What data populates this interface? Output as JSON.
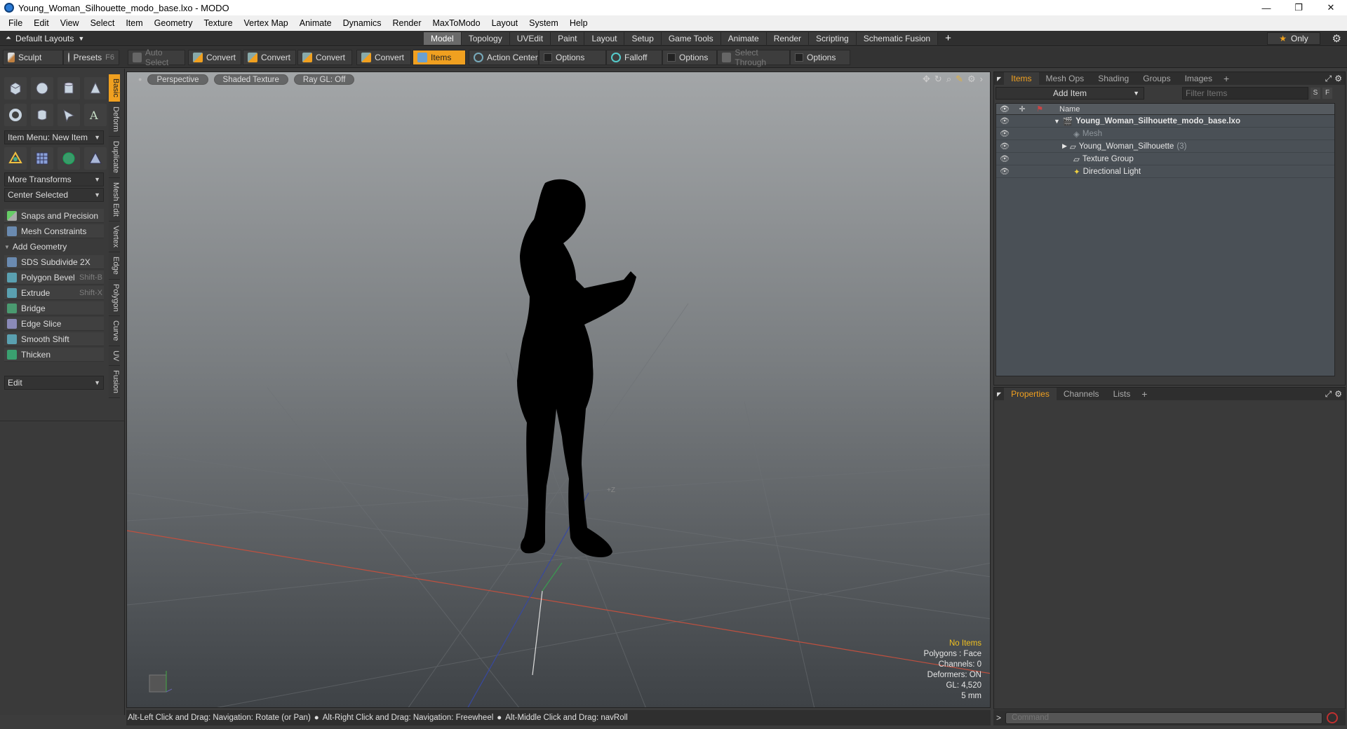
{
  "window": {
    "title": "Young_Woman_Silhouette_modo_base.lxo - MODO",
    "buttons": [
      "—",
      "❐",
      "✕"
    ]
  },
  "menubar": [
    "File",
    "Edit",
    "View",
    "Select",
    "Item",
    "Geometry",
    "Texture",
    "Vertex Map",
    "Animate",
    "Dynamics",
    "Render",
    "MaxToModo",
    "Layout",
    "System",
    "Help"
  ],
  "layoutbar": {
    "layout_name": "Default Layouts",
    "tabs": [
      "Model",
      "Topology",
      "UVEdit",
      "Paint",
      "Layout",
      "Setup",
      "Game Tools",
      "Animate",
      "Render",
      "Scripting",
      "Schematic Fusion"
    ],
    "active_tab": "Model",
    "add_tab": "+",
    "only_label": "Only"
  },
  "toolbar": {
    "sculpt": "Sculpt",
    "presets": "Presets",
    "presets_key": "F6",
    "auto_select": "Auto Select",
    "convert1": "Convert",
    "convert2": "Convert",
    "convert3": "Convert",
    "convert4": "Convert",
    "items": "Items",
    "action_center": "Action Center",
    "options1": "Options",
    "falloff": "Falloff",
    "options2": "Options",
    "select_through": "Select Through",
    "options3": "Options"
  },
  "left_panel": {
    "side_tabs": [
      "Basic",
      "Deform",
      "Duplicate",
      "Mesh Edit",
      "Vertex",
      "Edge",
      "Polygon",
      "Curve",
      "UV",
      "Fusion"
    ],
    "item_menu": "Item Menu: New Item",
    "more_transforms": "More Transforms",
    "center_selected": "Center Selected",
    "snaps": "Snaps and Precision",
    "mesh_constraints": "Mesh Constraints",
    "add_geometry": "Add Geometry",
    "tools": [
      {
        "label": "SDS Subdivide 2X",
        "shortcut": ""
      },
      {
        "label": "Polygon Bevel",
        "shortcut": "Shift-B"
      },
      {
        "label": "Extrude",
        "shortcut": "Shift-X"
      },
      {
        "label": "Bridge",
        "shortcut": ""
      },
      {
        "label": "Edge Slice",
        "shortcut": ""
      },
      {
        "label": "Smooth Shift",
        "shortcut": ""
      },
      {
        "label": "Thicken",
        "shortcut": ""
      }
    ],
    "edit_dropdown": "Edit"
  },
  "viewport": {
    "view_mode": "Perspective",
    "shading": "Shaded Texture",
    "raygl": "Ray GL: Off",
    "axis_z_label": "+Z",
    "info": {
      "selection": "No Items",
      "polygons": "Polygons : Face",
      "channels": "Channels: 0",
      "deformers": "Deformers: ON",
      "gl": "GL: 4,520",
      "scale": "5 mm"
    }
  },
  "statusbar": {
    "hint1": "Alt-Left Click and Drag: Navigation: Rotate (or Pan)",
    "hint2": "Alt-Right Click and Drag: Navigation: Freewheel",
    "hint3": "Alt-Middle Click and Drag: navRoll"
  },
  "items_panel": {
    "tabs": [
      "Items",
      "Mesh Ops",
      "Shading",
      "Groups",
      "Images"
    ],
    "active_tab": "Items",
    "add_item": "Add Item",
    "filter_placeholder": "Filter Items",
    "s_btn": "S",
    "f_btn": "F",
    "column_name": "Name",
    "tree": [
      {
        "label": "Young_Woman_Silhouette_modo_base.lxo",
        "count": ""
      },
      {
        "label": "Mesh",
        "count": ""
      },
      {
        "label": "Young_Woman_Silhouette",
        "count": "(3)"
      },
      {
        "label": "Texture Group",
        "count": ""
      },
      {
        "label": "Directional Light",
        "count": ""
      }
    ]
  },
  "props_panel": {
    "tabs": [
      "Properties",
      "Channels",
      "Lists"
    ],
    "active_tab": "Properties"
  },
  "command": {
    "prompt": ">",
    "placeholder": "Command"
  }
}
